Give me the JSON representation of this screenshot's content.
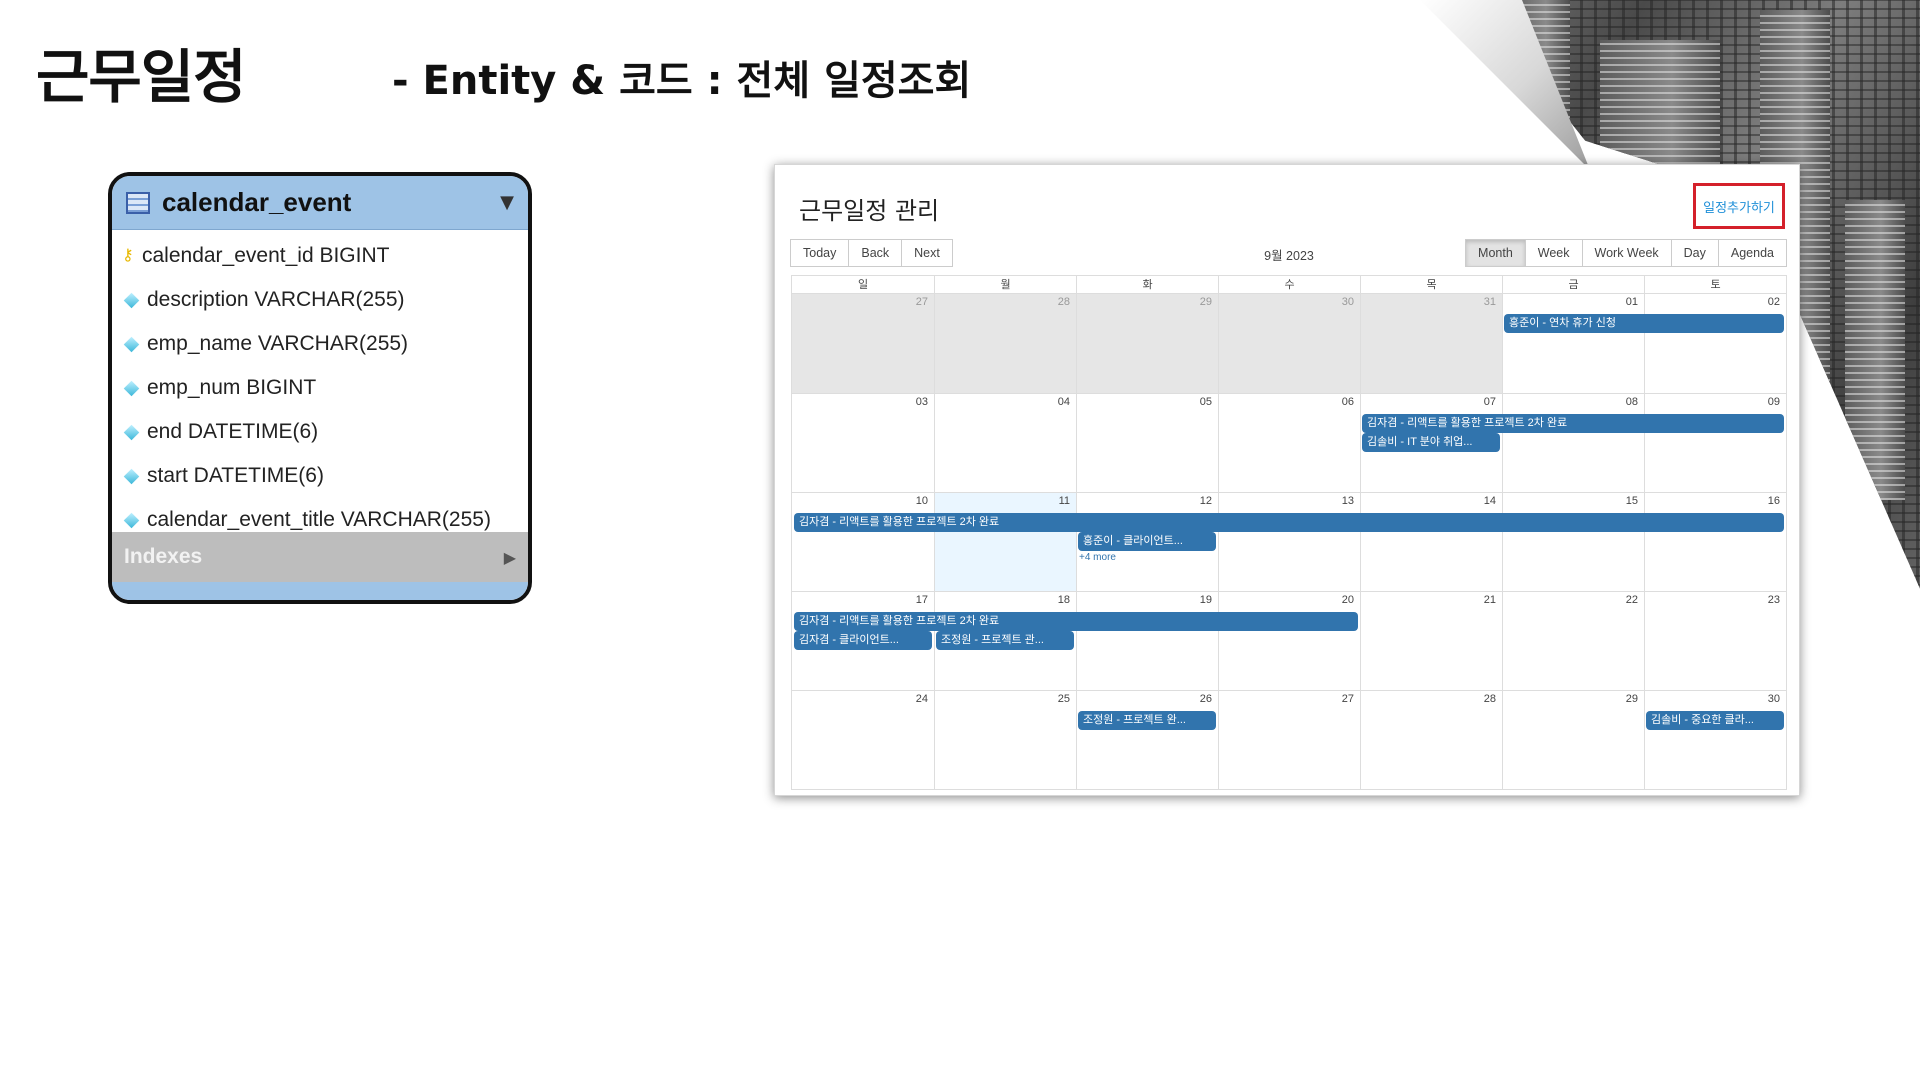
{
  "slide": {
    "title": "근무일정",
    "subtitle": "- Entity & 코드 : 전체 일정조회"
  },
  "erd": {
    "table_name": "calendar_event",
    "columns": [
      {
        "label": "calendar_event_id BIGINT",
        "icon": "primary-key-icon"
      },
      {
        "label": "description VARCHAR(255)",
        "icon": "column-diamond-icon"
      },
      {
        "label": "emp_name VARCHAR(255)",
        "icon": "column-diamond-icon"
      },
      {
        "label": "emp_num BIGINT",
        "icon": "column-diamond-icon"
      },
      {
        "label": "end DATETIME(6)",
        "icon": "column-diamond-icon"
      },
      {
        "label": "start DATETIME(6)",
        "icon": "column-diamond-icon"
      },
      {
        "label": "calendar_event_title VARCHAR(255)",
        "icon": "column-diamond-icon"
      }
    ],
    "indexes_label": "Indexes"
  },
  "calendar": {
    "title": "근무일정 관리",
    "add_button": "일정추가하기",
    "nav_buttons": [
      "Today",
      "Back",
      "Next"
    ],
    "month_label": "9월 2023",
    "view_buttons": [
      "Month",
      "Week",
      "Work Week",
      "Day",
      "Agenda"
    ],
    "active_view": "Month",
    "weekdays": [
      "일",
      "월",
      "화",
      "수",
      "목",
      "금",
      "토"
    ],
    "weeks": [
      {
        "days": [
          "27",
          "28",
          "29",
          "30",
          "31",
          "01",
          "02"
        ]
      },
      {
        "days": [
          "03",
          "04",
          "05",
          "06",
          "07",
          "08",
          "09"
        ]
      },
      {
        "days": [
          "10",
          "11",
          "12",
          "13",
          "14",
          "15",
          "16"
        ]
      },
      {
        "days": [
          "17",
          "18",
          "19",
          "20",
          "21",
          "22",
          "23"
        ]
      },
      {
        "days": [
          "24",
          "25",
          "26",
          "27",
          "28",
          "29",
          "30"
        ]
      }
    ],
    "outside_month_days": [
      "27",
      "28",
      "29",
      "30",
      "31"
    ],
    "today": "11",
    "events": [
      {
        "week": 0,
        "start": 5,
        "span": 2,
        "lane": 0,
        "title": "홍준이 - 연차 휴가 신청"
      },
      {
        "week": 1,
        "start": 4,
        "span": 3,
        "lane": 0,
        "title": "김자겸 - 리액트를 활용한 프로젝트 2차 완료"
      },
      {
        "week": 1,
        "start": 4,
        "span": 1,
        "lane": 1,
        "title": "김솔비 - IT 분야 취업..."
      },
      {
        "week": 2,
        "start": 0,
        "span": 7,
        "lane": 0,
        "title": "김자겸 - 리액트를 활용한 프로젝트 2차 완료"
      },
      {
        "week": 2,
        "start": 2,
        "span": 1,
        "lane": 1,
        "title": "홍준이 - 클라이언트..."
      },
      {
        "week": 3,
        "start": 0,
        "span": 4,
        "lane": 0,
        "title": "김자겸 - 리액트를 활용한 프로젝트 2차 완료"
      },
      {
        "week": 3,
        "start": 0,
        "span": 1,
        "lane": 1,
        "title": "김자겸 - 클라이언트..."
      },
      {
        "week": 3,
        "start": 1,
        "span": 1,
        "lane": 1,
        "title": "조정원 - 프로젝트 관..."
      },
      {
        "week": 4,
        "start": 2,
        "span": 1,
        "lane": 0,
        "title": "조정원 - 프로젝트 완..."
      },
      {
        "week": 4,
        "start": 6,
        "span": 1,
        "lane": 0,
        "title": "김솔비 - 중요한 클라..."
      }
    ],
    "more_links": [
      {
        "week": 2,
        "col": 2,
        "text": "+4 more"
      }
    ],
    "colors": {
      "event": "#3174ad",
      "today_bg": "#eaf6ff",
      "off_range_bg": "#e6e6e6",
      "add_border": "#d4202a",
      "add_text": "#1f8fd8"
    }
  }
}
